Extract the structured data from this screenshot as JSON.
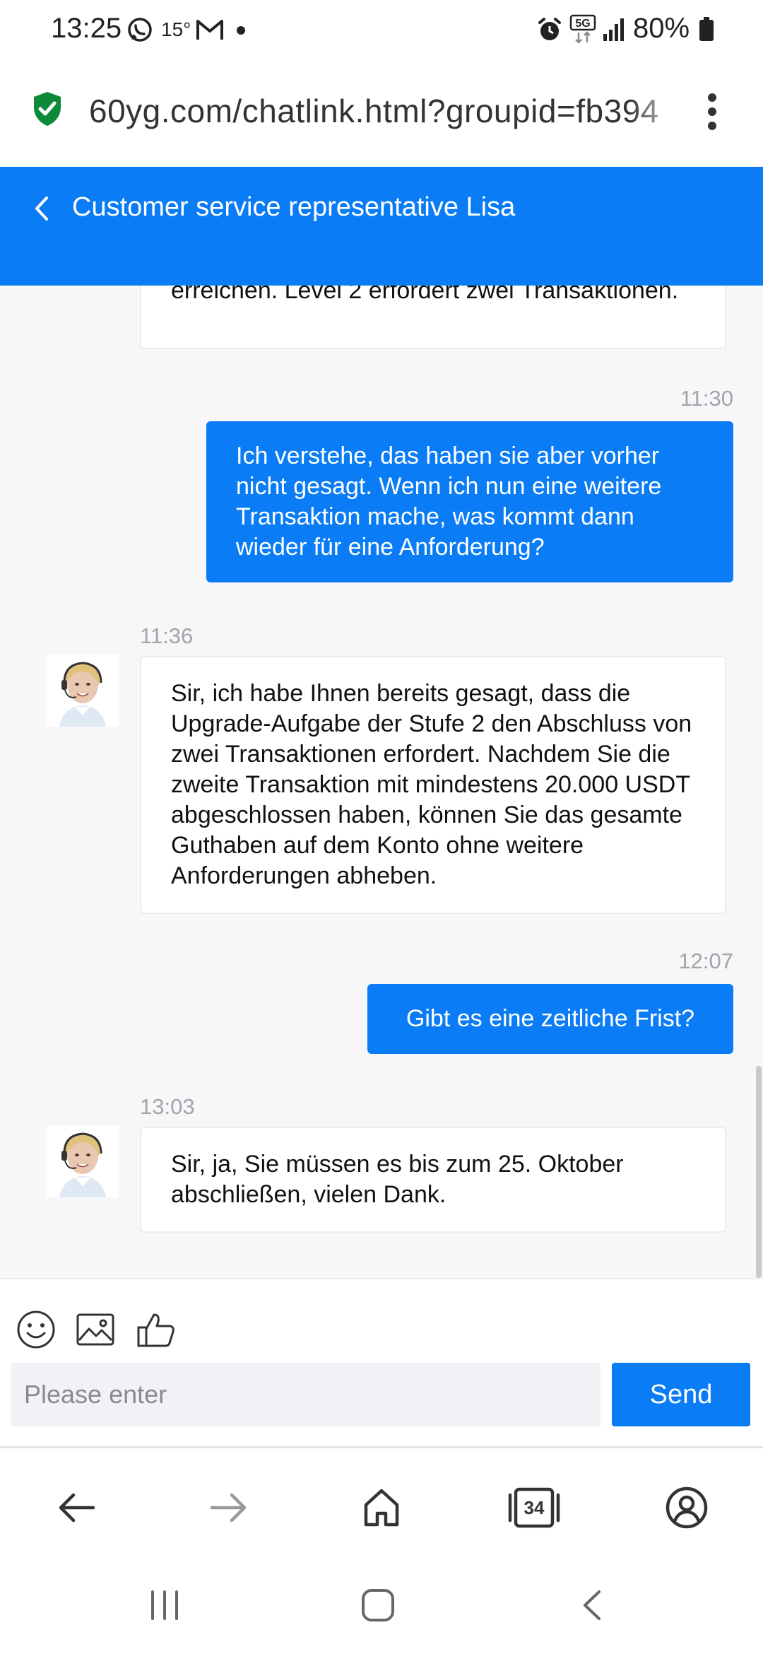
{
  "status_bar": {
    "time": "13:25",
    "temperature": "15°",
    "battery": "80%",
    "network": "5G"
  },
  "browser": {
    "url": "60yg.com/chatlink.html?groupid=fb394",
    "tabs_count": "34",
    "secure_color": "#0c8a3a"
  },
  "chat": {
    "title": "Customer service representative Lisa",
    "accent_color": "#0a7cf5",
    "messages": {
      "m0": {
        "text": "erreichen. Level 2 erfordert zwei Transaktionen."
      },
      "m1": {
        "time": "11:30",
        "text": "Ich verstehe, das haben sie aber vorher nicht gesagt. Wenn ich nun eine weitere Transaktion mache, was kommt dann wieder für eine Anforderung?"
      },
      "m2": {
        "time": "11:36",
        "text": "Sir, ich habe Ihnen bereits gesagt, dass die Upgrade-Aufgabe der Stufe 2 den Abschluss von zwei Transaktionen erfordert. Nachdem Sie die zweite Transaktion mit mindestens 20.000 USDT abgeschlossen haben, können Sie das gesamte Guthaben auf dem Konto ohne weitere Anforderungen abheben."
      },
      "m3": {
        "time": "12:07",
        "text": "Gibt es eine zeitliche Frist?"
      },
      "m4": {
        "time": "13:03",
        "text": "Sir, ja, Sie müssen es bis zum 25. Oktober abschließen, vielen Dank."
      }
    }
  },
  "input": {
    "placeholder": "Please enter",
    "value": "",
    "send_label": "Send"
  }
}
